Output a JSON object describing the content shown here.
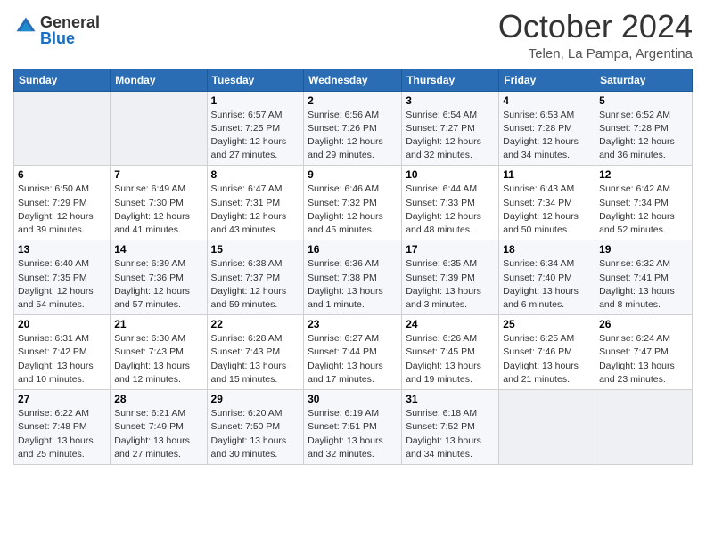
{
  "header": {
    "logo_general": "General",
    "logo_blue": "Blue",
    "month_title": "October 2024",
    "location": "Telen, La Pampa, Argentina"
  },
  "weekdays": [
    "Sunday",
    "Monday",
    "Tuesday",
    "Wednesday",
    "Thursday",
    "Friday",
    "Saturday"
  ],
  "weeks": [
    [
      {
        "day": "",
        "info": ""
      },
      {
        "day": "",
        "info": ""
      },
      {
        "day": "1",
        "info": "Sunrise: 6:57 AM\nSunset: 7:25 PM\nDaylight: 12 hours and 27 minutes."
      },
      {
        "day": "2",
        "info": "Sunrise: 6:56 AM\nSunset: 7:26 PM\nDaylight: 12 hours and 29 minutes."
      },
      {
        "day": "3",
        "info": "Sunrise: 6:54 AM\nSunset: 7:27 PM\nDaylight: 12 hours and 32 minutes."
      },
      {
        "day": "4",
        "info": "Sunrise: 6:53 AM\nSunset: 7:28 PM\nDaylight: 12 hours and 34 minutes."
      },
      {
        "day": "5",
        "info": "Sunrise: 6:52 AM\nSunset: 7:28 PM\nDaylight: 12 hours and 36 minutes."
      }
    ],
    [
      {
        "day": "6",
        "info": "Sunrise: 6:50 AM\nSunset: 7:29 PM\nDaylight: 12 hours and 39 minutes."
      },
      {
        "day": "7",
        "info": "Sunrise: 6:49 AM\nSunset: 7:30 PM\nDaylight: 12 hours and 41 minutes."
      },
      {
        "day": "8",
        "info": "Sunrise: 6:47 AM\nSunset: 7:31 PM\nDaylight: 12 hours and 43 minutes."
      },
      {
        "day": "9",
        "info": "Sunrise: 6:46 AM\nSunset: 7:32 PM\nDaylight: 12 hours and 45 minutes."
      },
      {
        "day": "10",
        "info": "Sunrise: 6:44 AM\nSunset: 7:33 PM\nDaylight: 12 hours and 48 minutes."
      },
      {
        "day": "11",
        "info": "Sunrise: 6:43 AM\nSunset: 7:34 PM\nDaylight: 12 hours and 50 minutes."
      },
      {
        "day": "12",
        "info": "Sunrise: 6:42 AM\nSunset: 7:34 PM\nDaylight: 12 hours and 52 minutes."
      }
    ],
    [
      {
        "day": "13",
        "info": "Sunrise: 6:40 AM\nSunset: 7:35 PM\nDaylight: 12 hours and 54 minutes."
      },
      {
        "day": "14",
        "info": "Sunrise: 6:39 AM\nSunset: 7:36 PM\nDaylight: 12 hours and 57 minutes."
      },
      {
        "day": "15",
        "info": "Sunrise: 6:38 AM\nSunset: 7:37 PM\nDaylight: 12 hours and 59 minutes."
      },
      {
        "day": "16",
        "info": "Sunrise: 6:36 AM\nSunset: 7:38 PM\nDaylight: 13 hours and 1 minute."
      },
      {
        "day": "17",
        "info": "Sunrise: 6:35 AM\nSunset: 7:39 PM\nDaylight: 13 hours and 3 minutes."
      },
      {
        "day": "18",
        "info": "Sunrise: 6:34 AM\nSunset: 7:40 PM\nDaylight: 13 hours and 6 minutes."
      },
      {
        "day": "19",
        "info": "Sunrise: 6:32 AM\nSunset: 7:41 PM\nDaylight: 13 hours and 8 minutes."
      }
    ],
    [
      {
        "day": "20",
        "info": "Sunrise: 6:31 AM\nSunset: 7:42 PM\nDaylight: 13 hours and 10 minutes."
      },
      {
        "day": "21",
        "info": "Sunrise: 6:30 AM\nSunset: 7:43 PM\nDaylight: 13 hours and 12 minutes."
      },
      {
        "day": "22",
        "info": "Sunrise: 6:28 AM\nSunset: 7:43 PM\nDaylight: 13 hours and 15 minutes."
      },
      {
        "day": "23",
        "info": "Sunrise: 6:27 AM\nSunset: 7:44 PM\nDaylight: 13 hours and 17 minutes."
      },
      {
        "day": "24",
        "info": "Sunrise: 6:26 AM\nSunset: 7:45 PM\nDaylight: 13 hours and 19 minutes."
      },
      {
        "day": "25",
        "info": "Sunrise: 6:25 AM\nSunset: 7:46 PM\nDaylight: 13 hours and 21 minutes."
      },
      {
        "day": "26",
        "info": "Sunrise: 6:24 AM\nSunset: 7:47 PM\nDaylight: 13 hours and 23 minutes."
      }
    ],
    [
      {
        "day": "27",
        "info": "Sunrise: 6:22 AM\nSunset: 7:48 PM\nDaylight: 13 hours and 25 minutes."
      },
      {
        "day": "28",
        "info": "Sunrise: 6:21 AM\nSunset: 7:49 PM\nDaylight: 13 hours and 27 minutes."
      },
      {
        "day": "29",
        "info": "Sunrise: 6:20 AM\nSunset: 7:50 PM\nDaylight: 13 hours and 30 minutes."
      },
      {
        "day": "30",
        "info": "Sunrise: 6:19 AM\nSunset: 7:51 PM\nDaylight: 13 hours and 32 minutes."
      },
      {
        "day": "31",
        "info": "Sunrise: 6:18 AM\nSunset: 7:52 PM\nDaylight: 13 hours and 34 minutes."
      },
      {
        "day": "",
        "info": ""
      },
      {
        "day": "",
        "info": ""
      }
    ]
  ]
}
